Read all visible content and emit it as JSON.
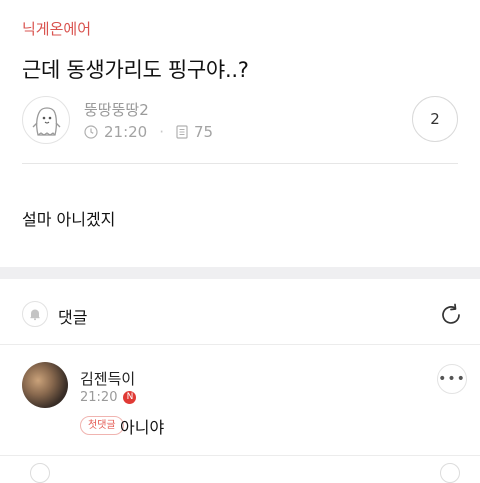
{
  "post": {
    "category": "닉게온에어",
    "title": "근데 동생가리도 핑구야..?",
    "author": "뚱땅뚱땅2",
    "time": "21:20",
    "views": "75",
    "comment_count": "2",
    "body": "설마 아니겠지"
  },
  "comments": {
    "header_label": "댓글",
    "items": [
      {
        "author": "김젠득이",
        "time": "21:20",
        "new_badge": "N",
        "first_badge": "첫댓글",
        "text": "아니야",
        "more": "•••"
      }
    ]
  },
  "icons": {
    "clock": "clock-icon",
    "views": "document-icon",
    "bell": "bell-icon",
    "refresh": "refresh-icon",
    "more": "more-dots-icon"
  },
  "colors": {
    "accent": "#d9534f",
    "badge_red": "#e03a35"
  }
}
